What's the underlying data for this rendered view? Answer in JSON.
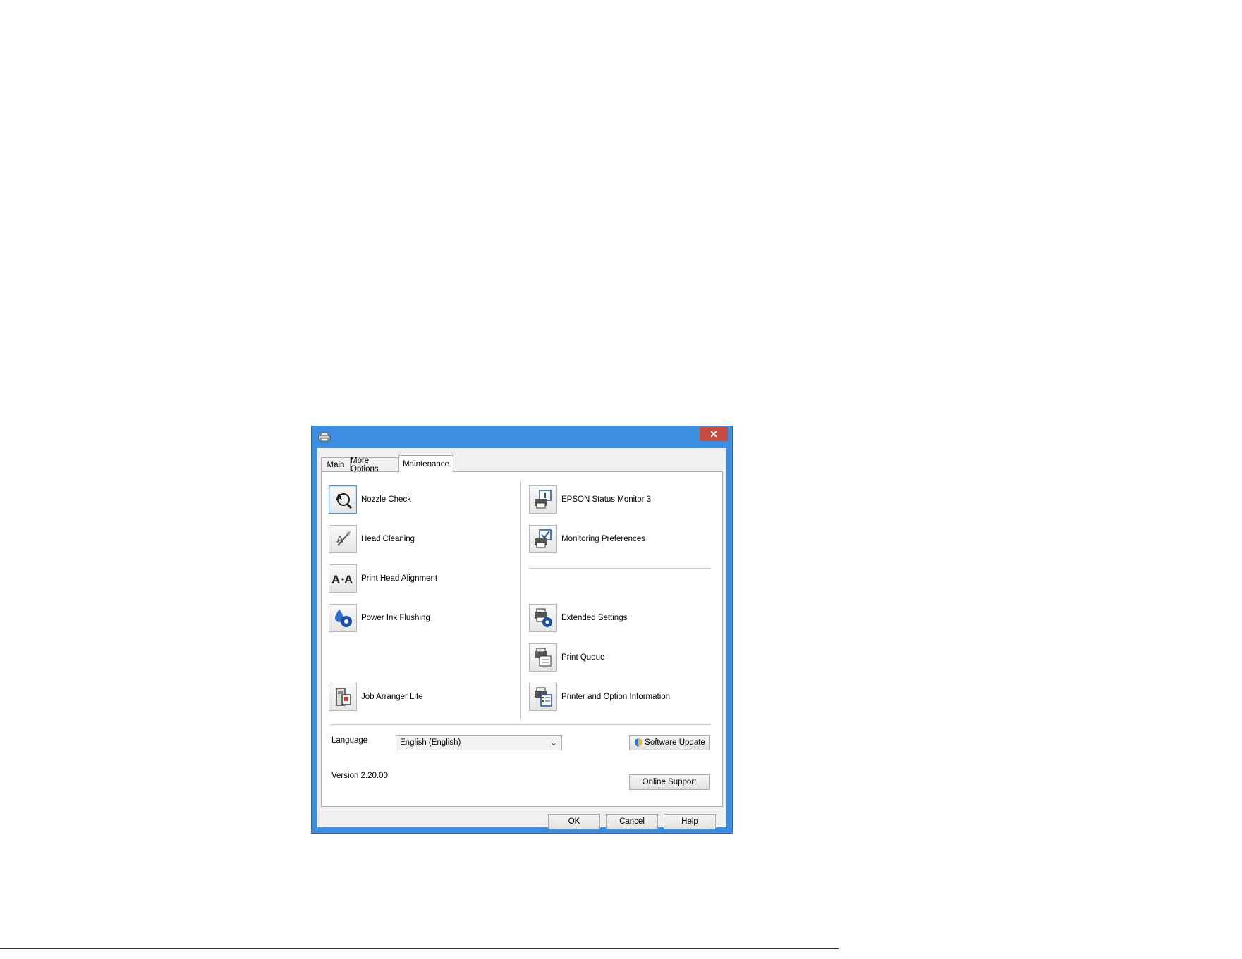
{
  "window": {
    "title_icon": "printer-icon",
    "close_label": "✕"
  },
  "tabs": [
    {
      "label": "Main"
    },
    {
      "label": "More Options"
    },
    {
      "label": "Maintenance"
    }
  ],
  "left_items": [
    {
      "label": "Nozzle Check",
      "icon": "nozzle-check-icon"
    },
    {
      "label": "Head Cleaning",
      "icon": "head-cleaning-icon"
    },
    {
      "label": "Print Head Alignment",
      "icon": "head-alignment-icon"
    },
    {
      "label": "Power Ink Flushing",
      "icon": "ink-flushing-icon"
    },
    {
      "label": "Job Arranger Lite",
      "icon": "job-arranger-icon"
    }
  ],
  "right_items": [
    {
      "label": "EPSON Status Monitor 3",
      "icon": "status-monitor-icon"
    },
    {
      "label": "Monitoring Preferences",
      "icon": "monitoring-preferences-icon"
    },
    {
      "label": "Extended Settings",
      "icon": "extended-settings-icon"
    },
    {
      "label": "Print Queue",
      "icon": "print-queue-icon"
    },
    {
      "label": "Printer and Option Information",
      "icon": "printer-info-icon"
    }
  ],
  "language": {
    "label": "Language",
    "value": "English (English)"
  },
  "version": "Version 2.20.00",
  "buttons": {
    "software_update": "Software Update",
    "online_support": "Online Support",
    "ok": "OK",
    "cancel": "Cancel",
    "help": "Help"
  },
  "colors": {
    "title_bar": "#3c8fe0",
    "close_button": "#c74a43",
    "dialog_bg": "#f0f0f0"
  }
}
